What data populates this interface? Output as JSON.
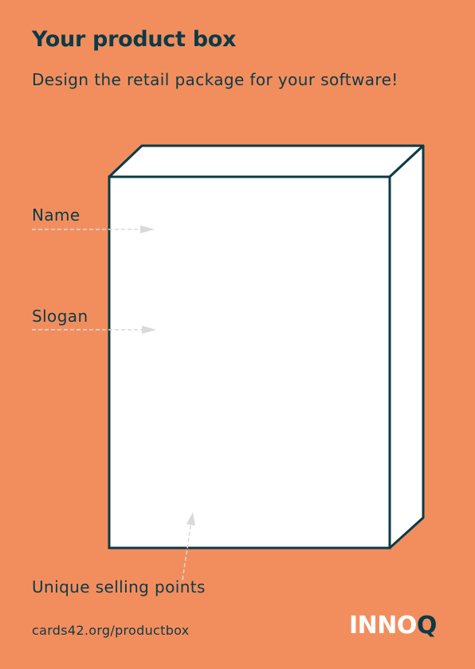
{
  "header": {
    "title": "Your product box",
    "subtitle": "Design the retail package for your software!"
  },
  "labels": {
    "name": "Name",
    "slogan": "Slogan",
    "usp": "Unique selling points"
  },
  "footer": {
    "url": "cards42.org/productbox",
    "logo_main": "INNO",
    "logo_accent": "Q"
  },
  "colors": {
    "background": "#F28E5E",
    "ink": "#0C3A47",
    "box_fill": "#FFFFFF",
    "arrow": "#D9D9D9"
  }
}
